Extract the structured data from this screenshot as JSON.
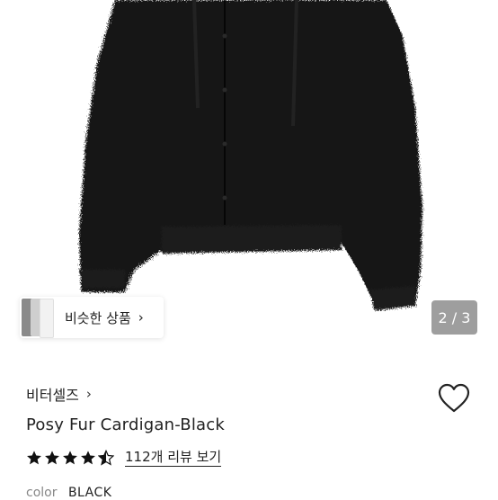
{
  "gallery": {
    "image_alt": "Posy Fur Cardigan-Black",
    "similar_label": "비슷한 상품",
    "similar_chevron": "›",
    "counter": "2 / 3"
  },
  "product": {
    "brand": "비터셀즈",
    "brand_chevron": "›",
    "title": "Posy Fur Cardigan-Black",
    "rating": 4.5,
    "review_link": "112개 리뷰 보기",
    "color_label": "color",
    "color_value": "BLACK"
  },
  "icons": {
    "heart": "heart-icon",
    "star": "star-icon",
    "half_star": "star-half-icon",
    "chevron": "chevron-right-icon"
  },
  "colors": {
    "garment": "#141414",
    "counter_bg": "#787878",
    "text": "#222222",
    "muted": "#888888"
  }
}
